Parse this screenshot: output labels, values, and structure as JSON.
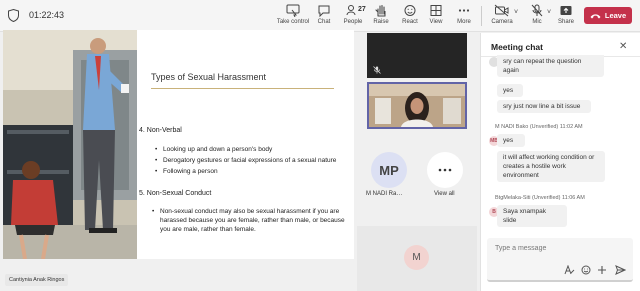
{
  "meeting": {
    "timer": "01:22:43"
  },
  "toolbar": {
    "take_control": "Take control",
    "chat": "Chat",
    "people": "People",
    "people_count": "27",
    "raise": "Raise",
    "react": "React",
    "view": "View",
    "more": "More",
    "camera": "Camera",
    "mic": "Mic",
    "share": "Share",
    "leave": "Leave",
    "leave_color": "#c4314b",
    "accent_color": "#6264a7"
  },
  "slide": {
    "title": "Types of Sexual Harassment",
    "sections": [
      {
        "heading": "4.      Non-Verbal",
        "bullets": [
          "Looking up and down a person's body",
          "Derogatory gestures or facial expressions of a sexual nature",
          "Following a person"
        ]
      },
      {
        "heading": "5.      Non-Sexual Conduct",
        "bullets": [
          "Non-sexual conduct may also be sexual harassment if you are harassed because you are female, rather than male, or because you are male, rather than female."
        ]
      }
    ]
  },
  "presenter": {
    "name": "Cantiynia Anak Ringos"
  },
  "participants": {
    "mp_initials": "MP",
    "mp_name": "M NADI Ra…",
    "view_all": "View all",
    "m_initial": "M"
  },
  "chat": {
    "title": "Meeting chat",
    "messages": [
      {
        "text": "sry can repeat the question again"
      },
      {
        "text": "yes"
      },
      {
        "text": "sry just now line a bit issue"
      },
      {
        "sender": "M NADI Bako (Unverified)",
        "time": "11:02 AM",
        "initials": "MB",
        "text": "yes"
      },
      {
        "text": "it will affect working condition or creates a hostile work environment"
      },
      {
        "sender": "BtgMelaka-Siti (Unverified)",
        "time": "11:06 AM",
        "initials": "B",
        "text": "Saya xnampak slide"
      }
    ],
    "placeholder": "Type a message"
  }
}
